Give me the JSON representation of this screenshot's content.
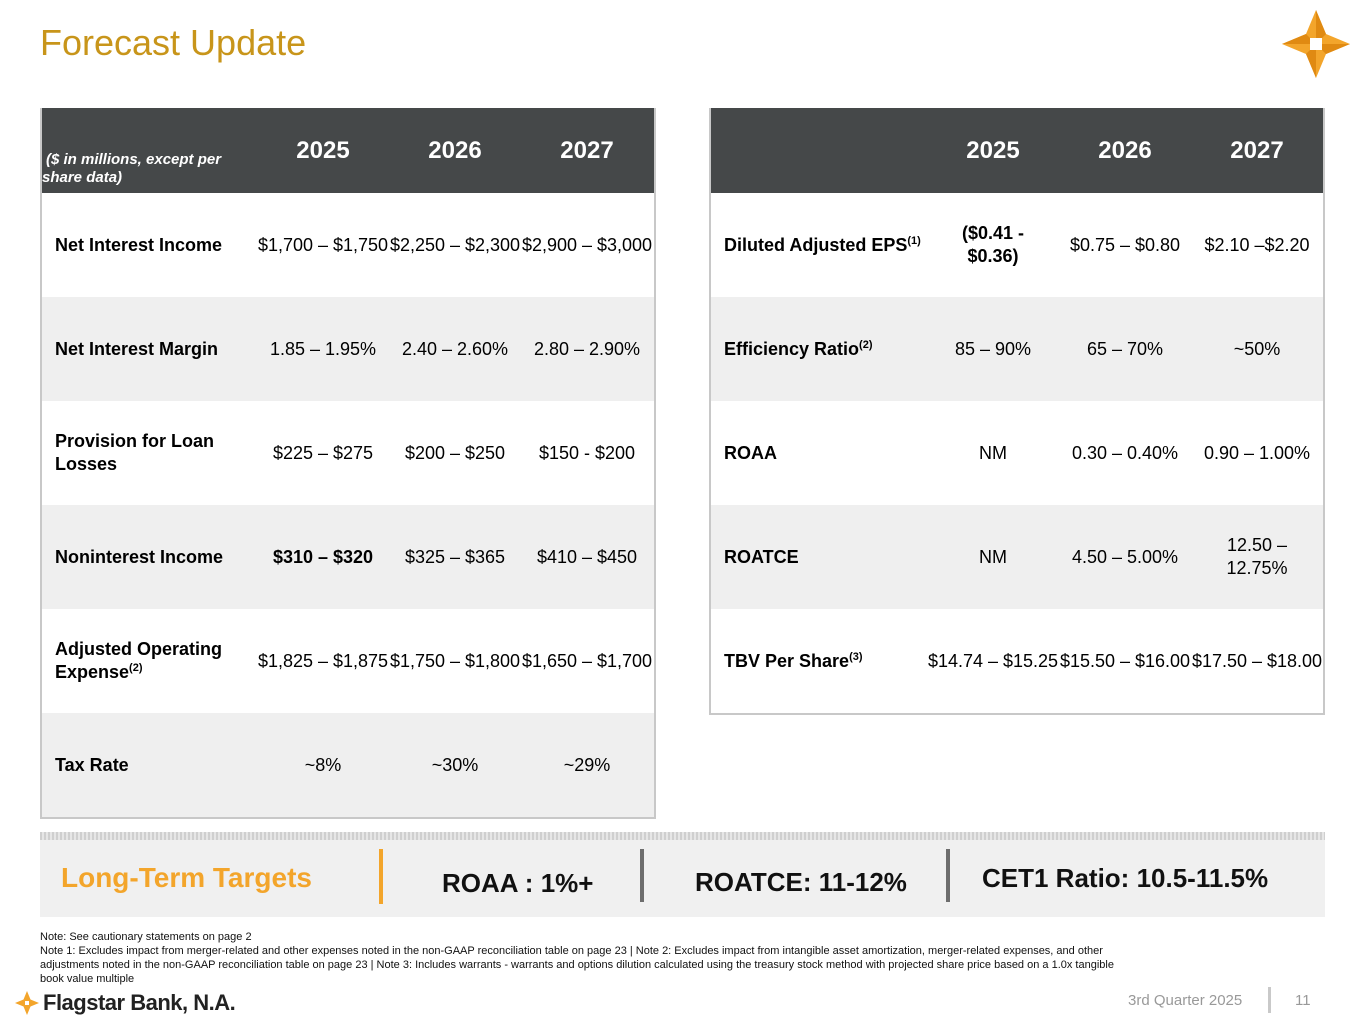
{
  "title": "Forecast Update",
  "colors": {
    "title": "#C8951A",
    "accent": "#F3A52B",
    "header_bg": "#454849",
    "row_shade": "#efefef"
  },
  "left_table": {
    "header_note": "($ in millions, except per share data)",
    "years": [
      "2025",
      "2026",
      "2027"
    ],
    "rows": [
      {
        "label": "Net Interest Income",
        "values": [
          "$1,700 – $1,750",
          "$2,250 – $2,300",
          "$2,900 – $3,000"
        ]
      },
      {
        "label": "Net Interest Margin",
        "values": [
          "1.85 – 1.95%",
          "2.40 – 2.60%",
          "2.80 – 2.90%"
        ]
      },
      {
        "label": "Provision for Loan Losses",
        "values": [
          "$225 – $275",
          "$200 – $250",
          "$150 - $200"
        ]
      },
      {
        "label": "Noninterest Income",
        "values": [
          "$310 – $320",
          "$325 – $365",
          "$410 – $450"
        ]
      },
      {
        "label": "Adjusted Operating Expense",
        "sup": "(2)",
        "values": [
          "$1,825 – $1,875",
          "$1,750 – $1,800",
          "$1,650 – $1,700"
        ]
      },
      {
        "label": "Tax Rate",
        "values": [
          "~8%",
          "~30%",
          "~29%"
        ]
      }
    ]
  },
  "right_table": {
    "years": [
      "2025",
      "2026",
      "2027"
    ],
    "rows": [
      {
        "label": "Diluted Adjusted EPS",
        "sup": "(1)",
        "values": [
          "($0.41 - $0.36)",
          "$0.75 – $0.80",
          "$2.10 –$2.20"
        ]
      },
      {
        "label": "Efficiency Ratio",
        "sup": "(2)",
        "values": [
          "85 – 90%",
          "65 – 70%",
          "~50%"
        ]
      },
      {
        "label": "ROAA",
        "values": [
          "NM",
          "0.30 – 0.40%",
          "0.90 – 1.00%"
        ]
      },
      {
        "label": "ROATCE",
        "values": [
          "NM",
          "4.50 – 5.00%",
          "12.50 – 12.75%"
        ]
      },
      {
        "label": "TBV Per Share",
        "sup": "(3)",
        "values": [
          "$14.74 – $15.25",
          "$15.50 – $16.00",
          "$17.50 – $18.00"
        ]
      }
    ]
  },
  "targets": {
    "label": "Long-Term Targets",
    "roaa": "ROAA : 1%+",
    "roatce": "ROATCE: 11-12%",
    "cet1": "CET1 Ratio: 10.5-11.5%"
  },
  "notes": {
    "line1": "Note: See cautionary statements on page 2",
    "line2": "Note 1: Excludes impact from merger-related and other expenses noted in the non-GAAP reconciliation table on page 23 | Note 2: Excludes impact from intangible asset amortization, merger-related expenses, and other adjustments noted in the non-GAAP reconciliation table on page 23   | Note 3: Includes warrants - warrants and options dilution calculated using the treasury stock method with projected share price based on a 1.0x tangible book value multiple"
  },
  "footer": {
    "brand": "Flagstar Bank, N.A.",
    "quarter": "3rd Quarter 2025",
    "page": "11"
  },
  "icons": {
    "logo": "star-logo-icon",
    "brand_mark": "flagstar-star-icon"
  }
}
